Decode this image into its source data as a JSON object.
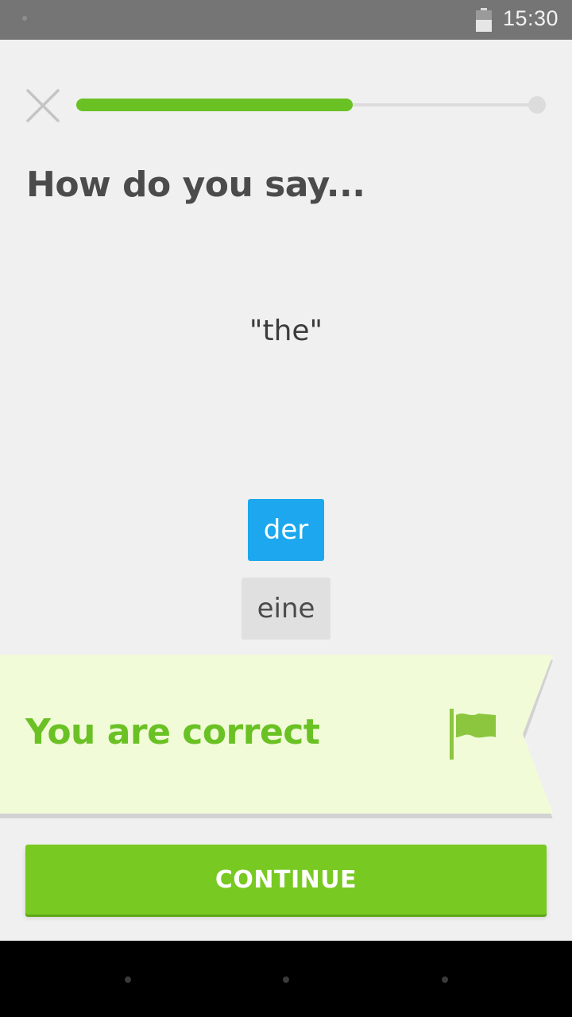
{
  "status_bar": {
    "time": "15:30",
    "icons": [
      "notification-dot",
      "battery-icon"
    ]
  },
  "lesson": {
    "progress": 0.6,
    "close_icon": "close-icon"
  },
  "question": {
    "title": "How do you say...",
    "prompt": "\"the\""
  },
  "options": [
    {
      "label": "der",
      "state": "selected"
    },
    {
      "label": "eine",
      "state": "unselected"
    }
  ],
  "feedback": {
    "message": "You are correct",
    "icon": "flag-icon"
  },
  "continue_button": {
    "label": "CONTINUE"
  },
  "colors": {
    "accent_green": "#78c922",
    "progress_green": "#6ac124",
    "selected_blue": "#1ca7ee",
    "feedback_background": "#f1fbd8"
  }
}
